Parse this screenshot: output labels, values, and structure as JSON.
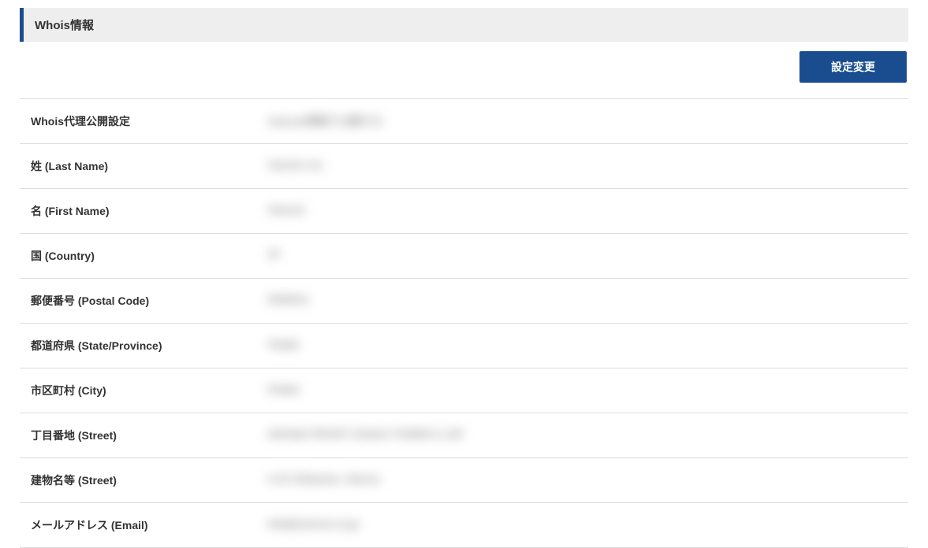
{
  "section": {
    "title": "Whois情報"
  },
  "actions": {
    "change_settings_label": "設定変更"
  },
  "fields": {
    "proxy": {
      "label": "Whois代理公開設定",
      "value": "Xserver情報で公開する"
    },
    "last_name": {
      "label": "姓 (Last Name)",
      "value": "Xserver Inc"
    },
    "first_name": {
      "label": "名 (First Name)",
      "value": "Xserver"
    },
    "country": {
      "label": "国 (Country)",
      "value": "JP"
    },
    "postal_code": {
      "label": "郵便番号 (Postal Code)",
      "value": "5300011"
    },
    "state": {
      "label": "都道府県 (State/Province)",
      "value": "Osaka"
    },
    "city": {
      "label": "市区町村 (City)",
      "value": "Osaka"
    },
    "street1": {
      "label": "丁目番地 (Street)",
      "value": "GRAND FRONT OSAKA TOWER A 13F"
    },
    "street2": {
      "label": "建物名等 (Street)",
      "value": "4-20 Ofukacho, Kita-ku"
    },
    "email": {
      "label": "メールアドレス (Email)",
      "value": "info@xserver.co.jp"
    }
  }
}
